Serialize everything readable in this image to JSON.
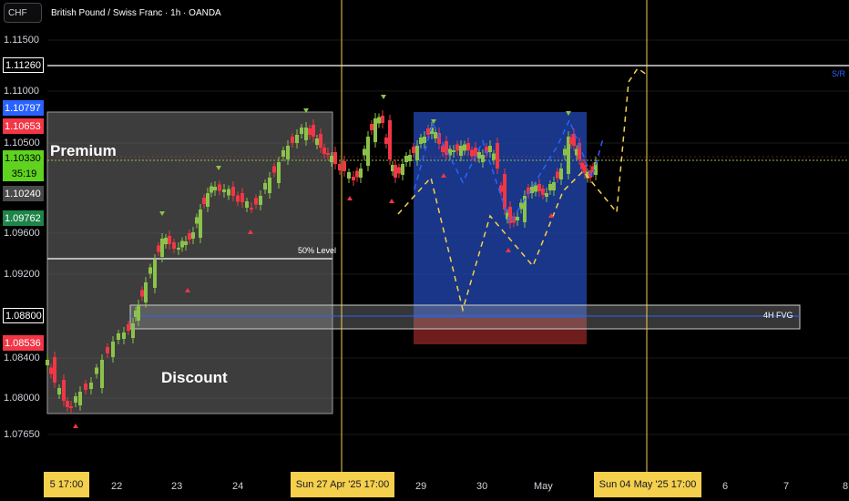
{
  "header": {
    "symbol_button": "CHF",
    "title": "British Pound / Swiss Franc · 1h · OANDA"
  },
  "colors": {
    "background": "#000000",
    "up_candle": "#8bc34a",
    "down_candle": "#f23645",
    "zone_gray": "#6f6f6f",
    "zone_blue": "#1e3fa0",
    "zone_red": "#7a1f1f",
    "guide_yellow": "#f5d04d",
    "pattern_yellow": "#f5d04d",
    "pattern_blue": "#2962ff"
  },
  "price_axis": {
    "labels": [
      "1.11500",
      "1.11000",
      "1.10500",
      "1.09600",
      "1.09200",
      "1.08400",
      "1.08000",
      "1.07650"
    ],
    "tags": [
      {
        "text": "1.11260",
        "style": "outline"
      },
      {
        "text": "1.10797",
        "style": "blue"
      },
      {
        "text": "1.10653",
        "style": "red"
      },
      {
        "text": "1.10330",
        "style": "green"
      },
      {
        "text": "35:19",
        "style": "green"
      },
      {
        "text": "1.10240",
        "style": "gray"
      },
      {
        "text": "1.09762",
        "style": "darkgreen"
      },
      {
        "text": "1.08800",
        "style": "outline"
      },
      {
        "text": "1.08536",
        "style": "red"
      }
    ]
  },
  "time_axis": {
    "labels": [
      "5   17:00",
      "22",
      "23",
      "24",
      "29",
      "30",
      "May",
      "6",
      "7",
      "8"
    ],
    "highlighted": [
      "Sun 27 Apr '25   17:00",
      "Sun 04 May '25   17:00"
    ]
  },
  "annotations": {
    "premium": "Premium",
    "discount": "Discount",
    "fifty_level": "50% Level",
    "sr": "S/R",
    "fvg": "4H  FVG"
  },
  "chart_data": {
    "type": "candlestick",
    "symbol": "GBPCHF",
    "timeframe": "1h",
    "ylim": [
      1.0755,
      1.1172
    ],
    "price_levels": {
      "sr": 1.1126,
      "fvg_top": 1.0897,
      "fvg_bottom": 1.0867,
      "fvg_mid": 1.088,
      "current": 1.1033,
      "fifty_percent": 1.0935
    },
    "zones": {
      "premium_discount_box": [
        1.0783,
        1.1083
      ],
      "blue_box": [
        1.0872,
        1.1083
      ],
      "red_box": [
        1.0849,
        1.0872
      ]
    }
  }
}
